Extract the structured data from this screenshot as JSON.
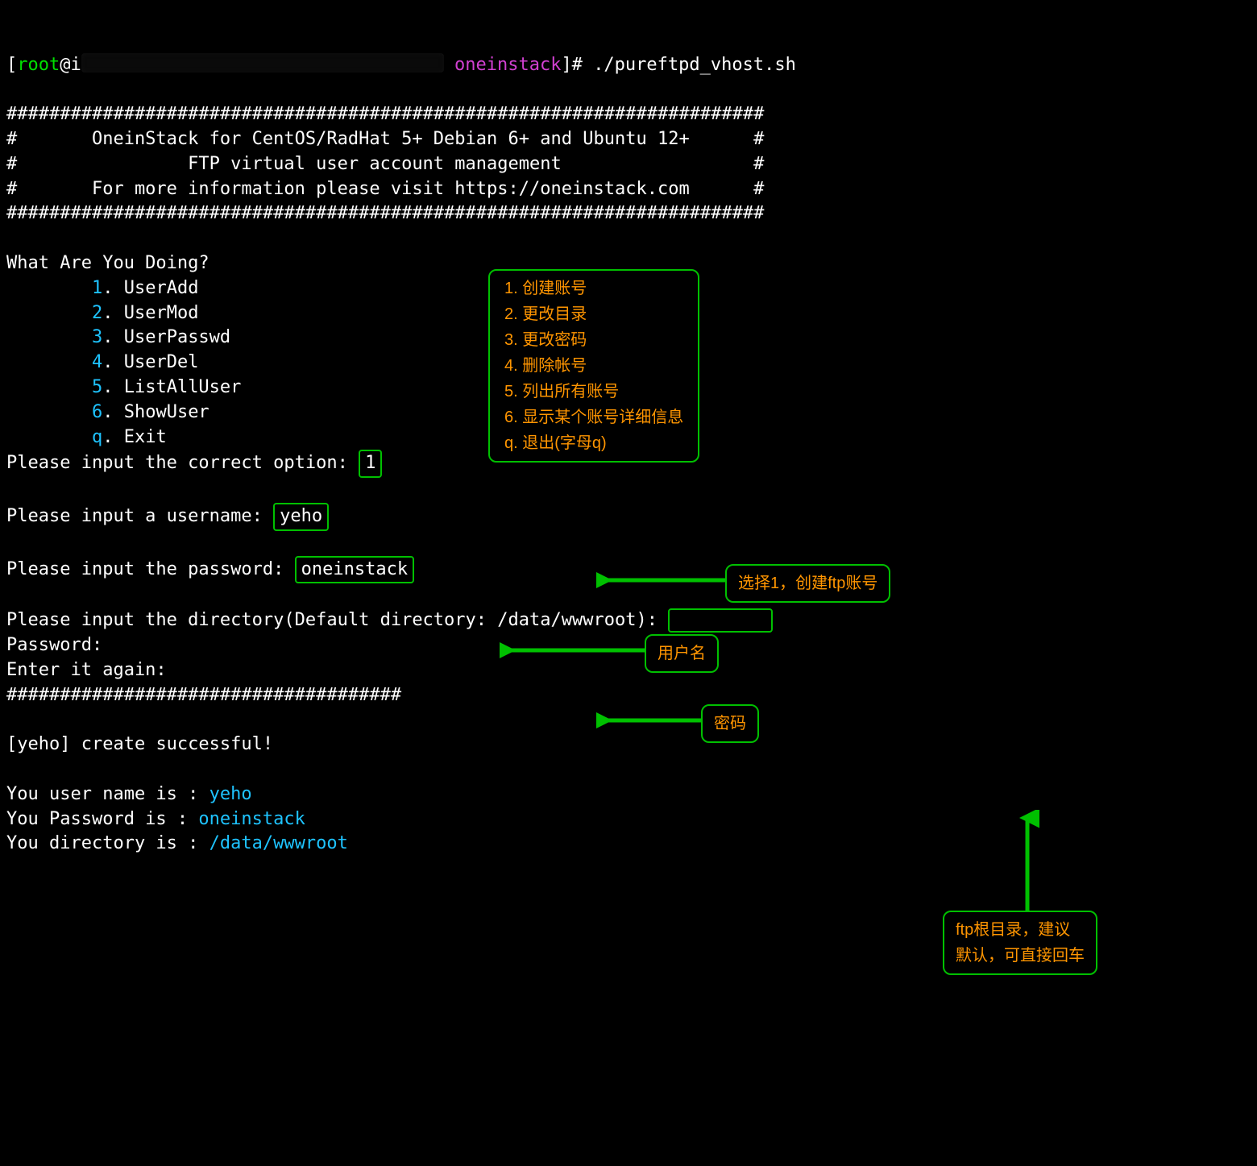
{
  "prompt": {
    "prefix": "[",
    "user": "root",
    "at": "@",
    "hostchar": "i",
    "dir": "oneinstack",
    "suffix": "]# ",
    "command": "./pureftpd_vhost.sh"
  },
  "banner": {
    "rule": "#######################################################################",
    "line1": "#       OneinStack for CentOS/RadHat 5+ Debian 6+ and Ubuntu 12+      #",
    "line2": "#                FTP virtual user account management                  #",
    "line3": "#       For more information please visit https://oneinstack.com      #"
  },
  "menu": {
    "title": "What Are You Doing?",
    "items": [
      {
        "num": "1",
        "label": "UserAdd"
      },
      {
        "num": "2",
        "label": "UserMod"
      },
      {
        "num": "3",
        "label": "UserPasswd"
      },
      {
        "num": "4",
        "label": "UserDel"
      },
      {
        "num": "5",
        "label": "ListAllUser"
      },
      {
        "num": "6",
        "label": "ShowUser"
      },
      {
        "num": "q",
        "label": "Exit"
      }
    ]
  },
  "menu_hint": {
    "1": "1. 创建账号",
    "2": "2. 更改目录",
    "3": "3. 更改密码",
    "4": "4. 删除帐号",
    "5": "5. 列出所有账号",
    "6": "6. 显示某个账号详细信息",
    "q": "q. 退出(字母q)"
  },
  "prompts": {
    "option_label": "Please input the correct option: ",
    "option_value": "1",
    "option_hint": "选择1，创建ftp账号",
    "user_label": "Please input a username: ",
    "user_value": "yeho",
    "user_hint": "用户名",
    "pass_label": "Please input the password: ",
    "pass_value": "oneinstack",
    "pass_hint": "密码",
    "dir_label": "Please input the directory(Default directory: /data/wwwroot): ",
    "dir_hint_l1": "ftp根目录，建议",
    "dir_hint_l2": "默认，可直接回车"
  },
  "tail": {
    "passwd": "Password:",
    "again": "Enter it again:",
    "rule": "#####################################",
    "success_pre": "[",
    "success_user": "yeho",
    "success_post": "] create successful!",
    "out_user_l": "You user name is : ",
    "out_user_v": "yeho",
    "out_pass_l": "You Password is : ",
    "out_pass_v": "oneinstack",
    "out_dir_l": "You directory is : ",
    "out_dir_v": "/data/wwwroot"
  },
  "colors": {
    "accent_green": "#00c000",
    "accent_orange": "#ff9500",
    "accent_cyan": "#1ec3ff",
    "accent_magenta": "#d040d0"
  }
}
